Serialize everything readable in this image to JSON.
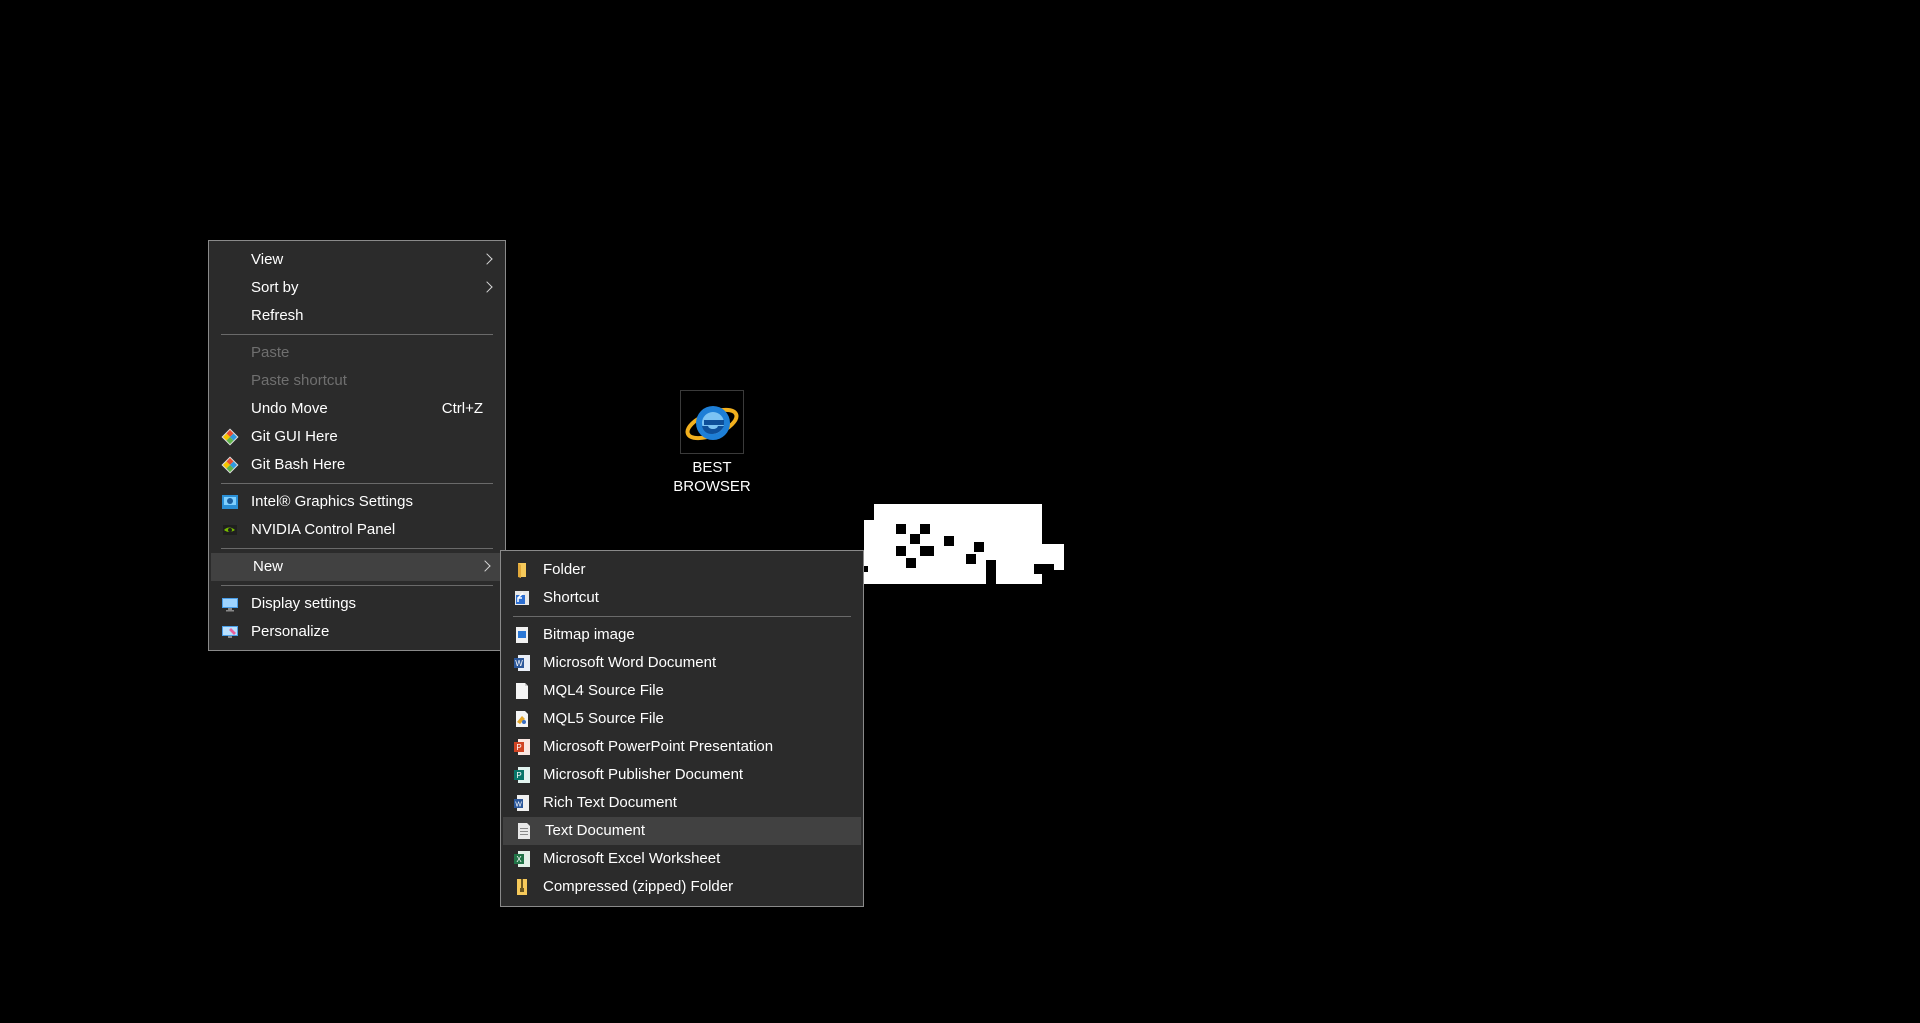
{
  "desktop": {
    "background": "#000000",
    "icon": {
      "label_line1": "BEST",
      "label_line2": "BROWSER",
      "icon_name": "internet-explorer-icon"
    }
  },
  "context_menu": {
    "items": [
      {
        "label": "View",
        "submenu": true
      },
      {
        "label": "Sort by",
        "submenu": true
      },
      {
        "label": "Refresh"
      },
      {
        "label": "Paste",
        "disabled": true
      },
      {
        "label": "Paste shortcut",
        "disabled": true
      },
      {
        "label": "Undo Move",
        "shortcut": "Ctrl+Z"
      },
      {
        "label": "Git GUI Here",
        "icon": "git-icon"
      },
      {
        "label": "Git Bash Here",
        "icon": "git-icon"
      },
      {
        "label": "Intel® Graphics Settings",
        "icon": "intel-graphics-icon"
      },
      {
        "label": "NVIDIA Control Panel",
        "icon": "nvidia-icon"
      },
      {
        "label": "New",
        "submenu": true,
        "highlighted": true
      },
      {
        "label": "Display settings",
        "icon": "display-icon"
      },
      {
        "label": "Personalize",
        "icon": "personalize-icon"
      }
    ]
  },
  "new_submenu": {
    "items": [
      {
        "label": "Folder",
        "icon": "folder-icon"
      },
      {
        "label": "Shortcut",
        "icon": "shortcut-icon"
      },
      {
        "label": "Bitmap image",
        "icon": "bitmap-icon"
      },
      {
        "label": "Microsoft Word Document",
        "icon": "word-icon"
      },
      {
        "label": "MQL4 Source File",
        "icon": "blank-file-icon"
      },
      {
        "label": "MQL5 Source File",
        "icon": "mql5-icon"
      },
      {
        "label": "Microsoft PowerPoint Presentation",
        "icon": "powerpoint-icon"
      },
      {
        "label": "Microsoft Publisher Document",
        "icon": "publisher-icon"
      },
      {
        "label": "Rich Text Document",
        "icon": "rtf-icon"
      },
      {
        "label": "Text Document",
        "icon": "text-file-icon",
        "highlighted": true
      },
      {
        "label": "Microsoft Excel Worksheet",
        "icon": "excel-icon"
      },
      {
        "label": "Compressed (zipped) Folder",
        "icon": "zip-folder-icon"
      }
    ]
  },
  "colors": {
    "menu_bg": "#2b2b2b",
    "menu_border": "#8a8a8a",
    "highlight": "#414141",
    "disabled_text": "#6f6f6f",
    "text": "#ffffff"
  }
}
